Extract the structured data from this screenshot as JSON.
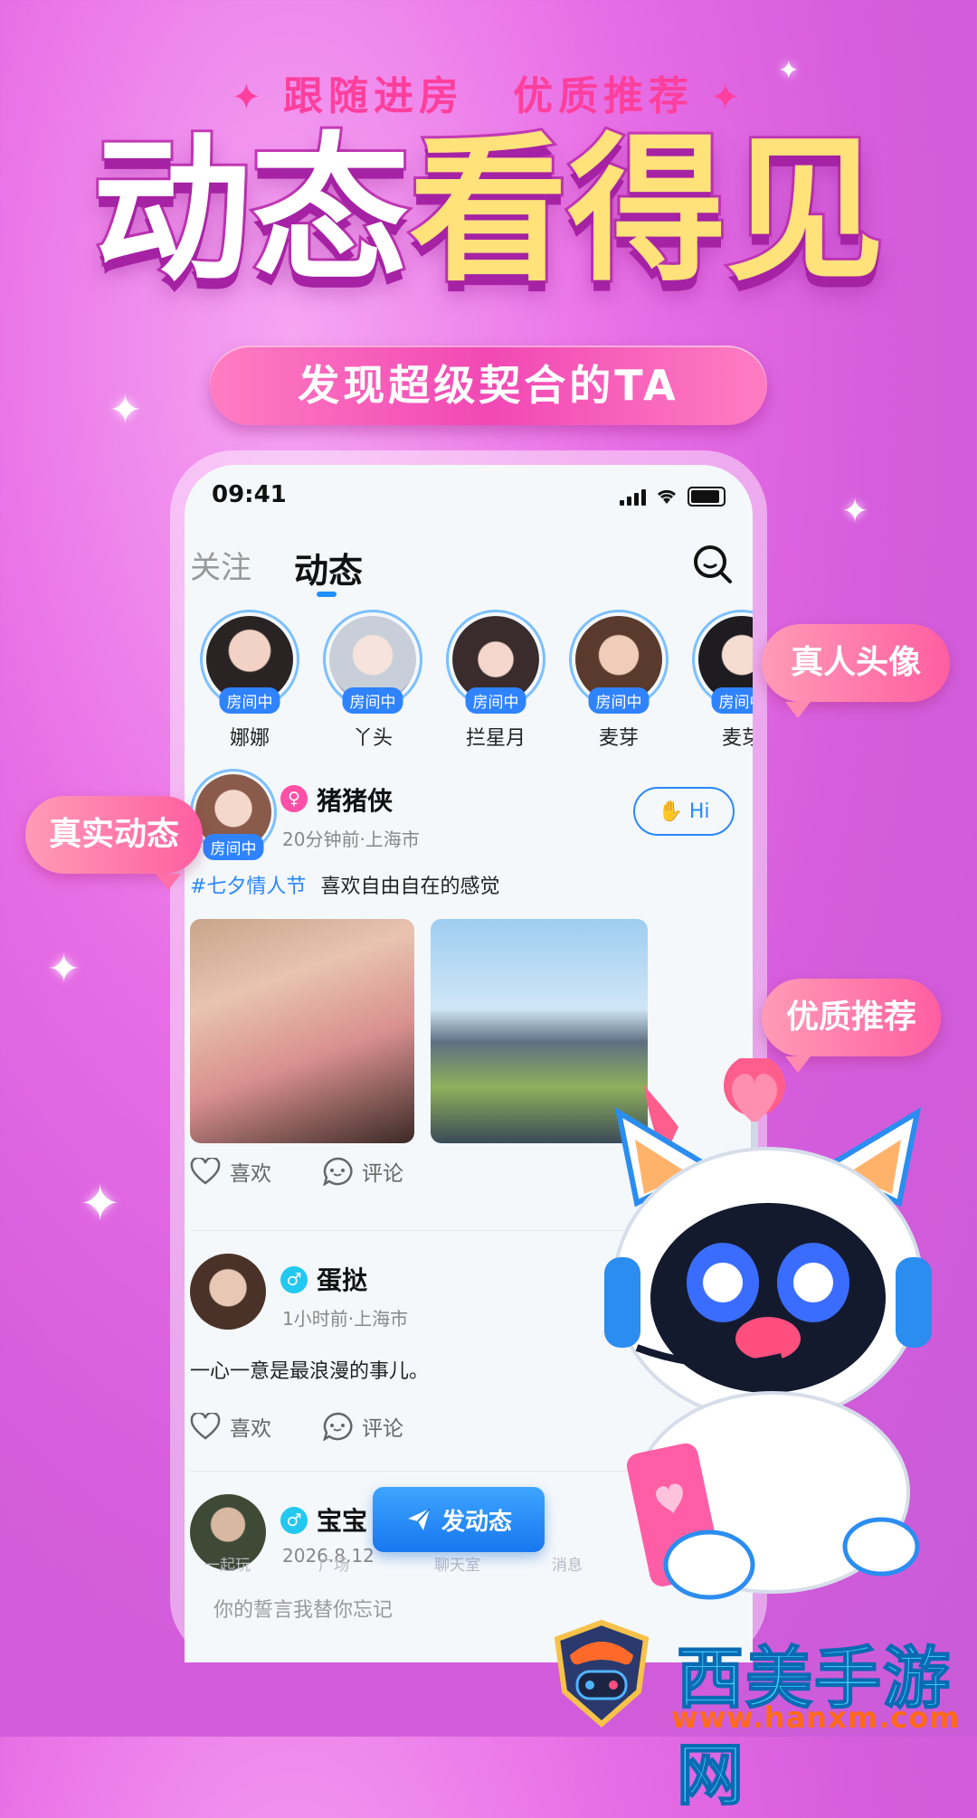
{
  "header": {
    "tagline_left": "跟随进房",
    "tagline_right": "优质推荐",
    "hero_white": "动态",
    "hero_gold": "看得见",
    "subtitle": "发现超级契合的TA"
  },
  "status_bar": {
    "time": "09:41"
  },
  "tabs": {
    "follow": "关注",
    "moments": "动态"
  },
  "stories": [
    {
      "name": "娜娜",
      "badge": "房间中"
    },
    {
      "name": "丫头",
      "badge": "房间中"
    },
    {
      "name": "拦星月",
      "badge": "房间中"
    },
    {
      "name": "麦芽",
      "badge": "房间中"
    },
    {
      "name": "麦芽",
      "badge": "房间中"
    }
  ],
  "posts": [
    {
      "name": "猪猪侠",
      "badge": "房间中",
      "meta": "20分钟前·上海市",
      "topic": "#七夕情人节",
      "text": "喜欢自由自在的感觉",
      "hi": "Hi",
      "like": "喜欢",
      "comment": "评论"
    },
    {
      "name": "蛋挞",
      "meta": "1小时前·上海市",
      "text": "一心一意是最浪漫的事儿。",
      "like": "喜欢",
      "comment": "评论"
    },
    {
      "name": "宝宝",
      "meta": "2026.8.12",
      "text": "你的誓言我替你忘记"
    }
  ],
  "bottom_nav": [
    "一起玩",
    "广场",
    "聊天室",
    "消息"
  ],
  "publish_button": "发动态",
  "bubbles": {
    "avatar": "真人头像",
    "real": "真实动态",
    "quality": "优质推荐"
  },
  "watermark": {
    "title": "西美手游网",
    "url": "www.hanxm.com"
  },
  "colors": {
    "accent_blue": "#2a88ff",
    "pink": "#ff3f9d",
    "gold": "#ffe27a"
  }
}
